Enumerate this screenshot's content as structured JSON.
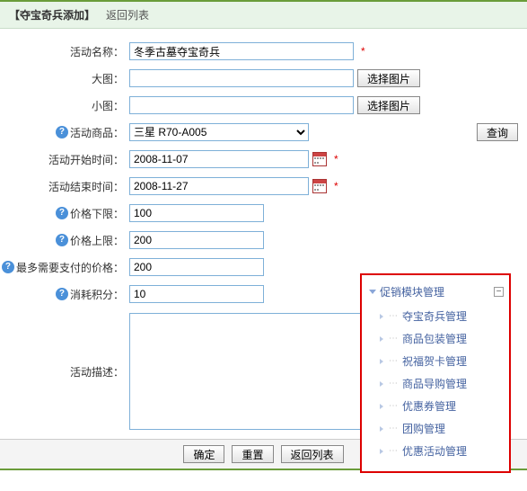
{
  "header": {
    "title": "【夺宝奇兵添加】",
    "back_link": "返回列表"
  },
  "form": {
    "name_label": "活动名称：",
    "name_value": "冬季古墓夺宝奇兵",
    "big_img_label": "大图：",
    "big_img_value": "",
    "select_img_btn": "选择图片",
    "small_img_label": "小图：",
    "small_img_value": "",
    "product_label": "活动商品：",
    "product_value": "三星 R70-A005",
    "query_btn": "查询",
    "start_label": "活动开始时间：",
    "start_value": "2008-11-07",
    "end_label": "活动结束时间：",
    "end_value": "2008-11-27",
    "price_low_label": "价格下限：",
    "price_low_value": "100",
    "price_high_label": "价格上限：",
    "price_high_value": "200",
    "max_pay_label": "最多需要支付的价格：",
    "max_pay_value": "200",
    "points_label": "消耗积分：",
    "points_value": "10",
    "desc_label": "活动描述：",
    "desc_value": ""
  },
  "footer": {
    "confirm": "确定",
    "reset": "重置",
    "back": "返回列表"
  },
  "popup": {
    "head": "促销模块管理",
    "items": [
      "夺宝奇兵管理",
      "商品包装管理",
      "祝福贺卡管理",
      "商品导购管理",
      "优惠券管理",
      "团购管理",
      "优惠活动管理"
    ]
  }
}
